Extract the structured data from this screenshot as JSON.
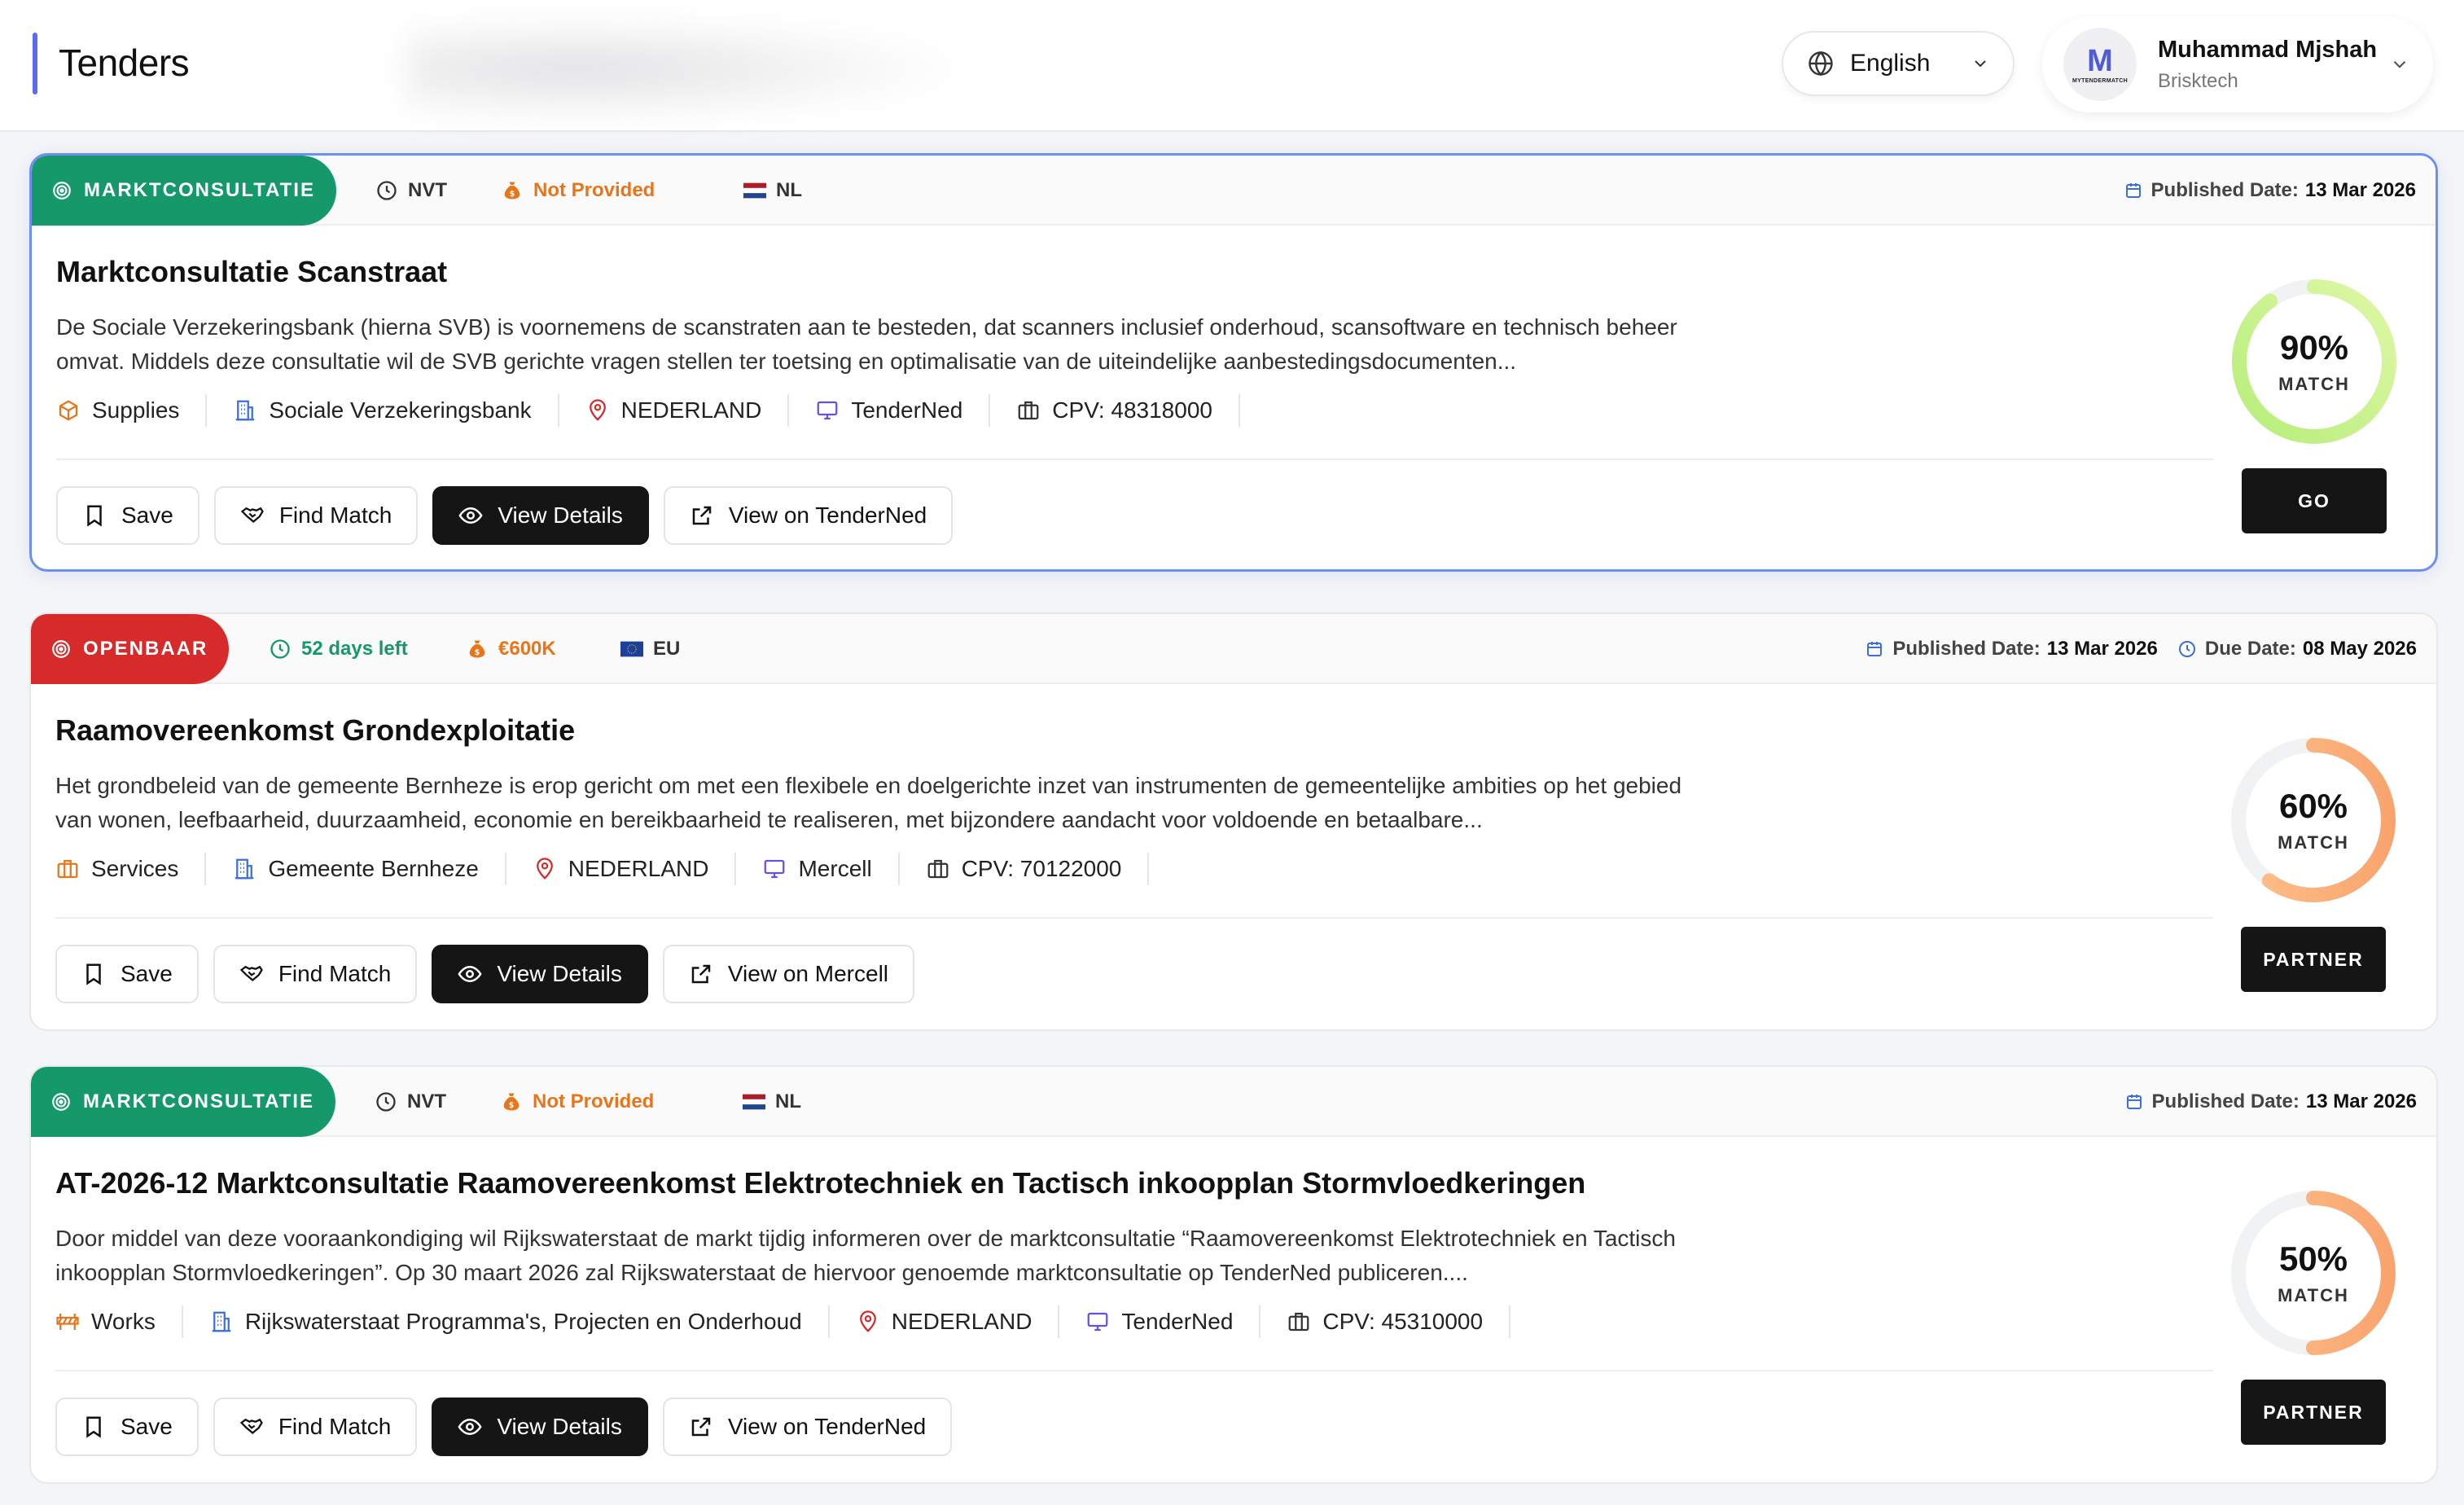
{
  "header": {
    "title": "Tenders",
    "language": "English",
    "user": {
      "name": "Muhammad Mjshah",
      "org": "Brisktech",
      "avatar_letter": "M",
      "avatar_caption": "MYTENDERMATCH"
    }
  },
  "actions": {
    "save": "Save",
    "find_match": "Find Match",
    "view_details": "View Details",
    "match_label": "MATCH"
  },
  "labels": {
    "published": "Published Date:",
    "due": "Due Date:"
  },
  "colors": {
    "marktconsultatie": "#15996a",
    "openbaar": "#d72a2a",
    "accent": "#5b6cf0",
    "dark_button": "#151515"
  },
  "tenders": [
    {
      "status": "MARKTCONSULTATIE",
      "deadline": "NVT",
      "value": "Not Provided",
      "region": "NL",
      "published": "13 Mar 2026",
      "due": "",
      "title": "Marktconsultatie Scanstraat",
      "description": "De Sociale Verzekeringsbank (hierna SVB) is voornemens de scanstraten aan te besteden, dat scanners inclusief onderhoud, scansoftware en technisch beheer omvat. Middels deze consultatie wil de SVB gerichte vragen stellen ter toetsing en optimalisatie van de uiteindelijke aanbestedingsdocumenten...",
      "category": "Supplies",
      "category_icon": "cube-icon",
      "buyer": "Sociale Verzekeringsbank",
      "country": "NEDERLAND",
      "source": "TenderNed",
      "cpv": "CPV: 48318000",
      "view_on": "View on TenderNed",
      "match": 90,
      "match_text": "90%",
      "recommendation": "GO"
    },
    {
      "status": "OPENBAAR",
      "deadline": "52 days left",
      "value": "€600K",
      "region": "EU",
      "published": "13 Mar 2026",
      "due": "08 May 2026",
      "title": "Raamovereenkomst Grondexploitatie",
      "description": "Het grondbeleid van de gemeente Bernheze is erop gericht om met een flexibele en doelgerichte  inzet van instrumenten de gemeentelijke ambities op het gebied van wonen, leefbaarheid, duurzaamheid, economie en bereikbaarheid te realiseren, met bijzondere aandacht voor voldoende en  betaalbare...",
      "category": "Services",
      "category_icon": "briefcase-icon",
      "buyer": "Gemeente Bernheze",
      "country": "NEDERLAND",
      "source": "Mercell",
      "cpv": "CPV: 70122000",
      "view_on": "View on Mercell",
      "match": 60,
      "match_text": "60%",
      "recommendation": "PARTNER"
    },
    {
      "status": "MARKTCONSULTATIE",
      "deadline": "NVT",
      "value": "Not Provided",
      "region": "NL",
      "published": "13 Mar 2026",
      "due": "",
      "title": "AT-2026-12 Marktconsultatie Raamovereenkomst Elektrotechniek en Tactisch inkoopplan Stormvloedkeringen",
      "description": "Door middel van deze vooraankondiging wil Rijkswaterstaat de markt tijdig informeren over de marktconsultatie “Raamovereenkomst Elektrotechniek en Tactisch inkoopplan Stormvloedkeringen”. Op 30 maart 2026 zal Rijkswaterstaat de hiervoor genoemde marktconsultatie op TenderNed publiceren....",
      "category": "Works",
      "category_icon": "barrier-icon",
      "buyer": "Rijkswaterstaat Programma's, Projecten en Onderhoud",
      "country": "NEDERLAND",
      "source": "TenderNed",
      "cpv": "CPV: 45310000",
      "view_on": "View on TenderNed",
      "match": 50,
      "match_text": "50%",
      "recommendation": "PARTNER"
    }
  ]
}
